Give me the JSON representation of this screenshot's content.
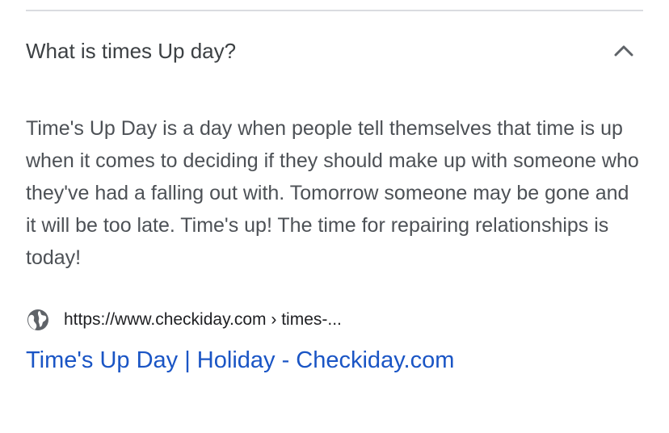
{
  "faq": {
    "question": "What is times Up day?",
    "expanded": true,
    "toggle_icon": "chevron-up-icon",
    "answer": "Time's Up Day is a day when people tell themselves that time is up when it comes to deciding if they should make up with someone who they've had a falling out with. Tomorrow someone may be gone and it will be too late. Time's up! The time for repairing relationships is today!"
  },
  "source": {
    "icon": "globe-icon",
    "url": "https://www.checkiday.com › times-...",
    "link_title": "Time's Up Day | Holiday - Checkiday.com"
  },
  "colors": {
    "divider": "#dadce0",
    "question_text": "#3c4043",
    "answer_text": "#4d5156",
    "url_text": "#202124",
    "link": "#1a55c5",
    "icon": "#5f6368"
  }
}
